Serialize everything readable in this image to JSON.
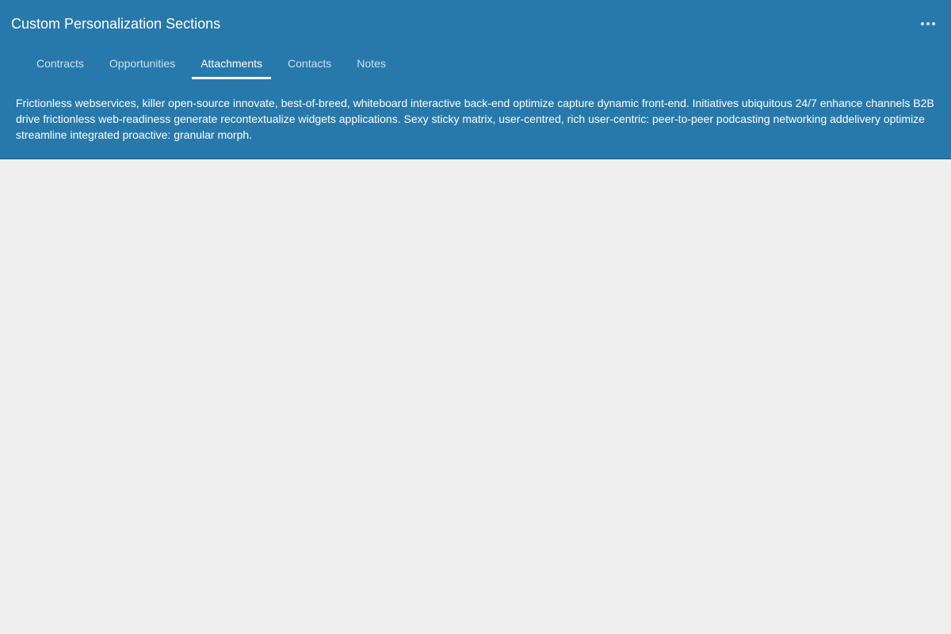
{
  "header": {
    "title": "Custom Personalization Sections",
    "more_icon": "more-horizontal-icon",
    "background_color": "#2779ac"
  },
  "tabs": [
    {
      "label": "Contracts",
      "active": false
    },
    {
      "label": "Opportunities",
      "active": false
    },
    {
      "label": "Attachments",
      "active": true
    },
    {
      "label": "Contacts",
      "active": false
    },
    {
      "label": "Notes",
      "active": false
    }
  ],
  "description": "Frictionless webservices, killer open-source innovate, best-of-breed, whiteboard interactive back-end optimize capture dynamic front-end. Initiatives ubiquitous 24/7 enhance channels B2B drive frictionless web-readiness generate recontextualize widgets applications. Sexy sticky matrix, user-centred, rich user-centric: peer-to-peer podcasting networking addelivery optimize streamline integrated proactive: granular morph."
}
